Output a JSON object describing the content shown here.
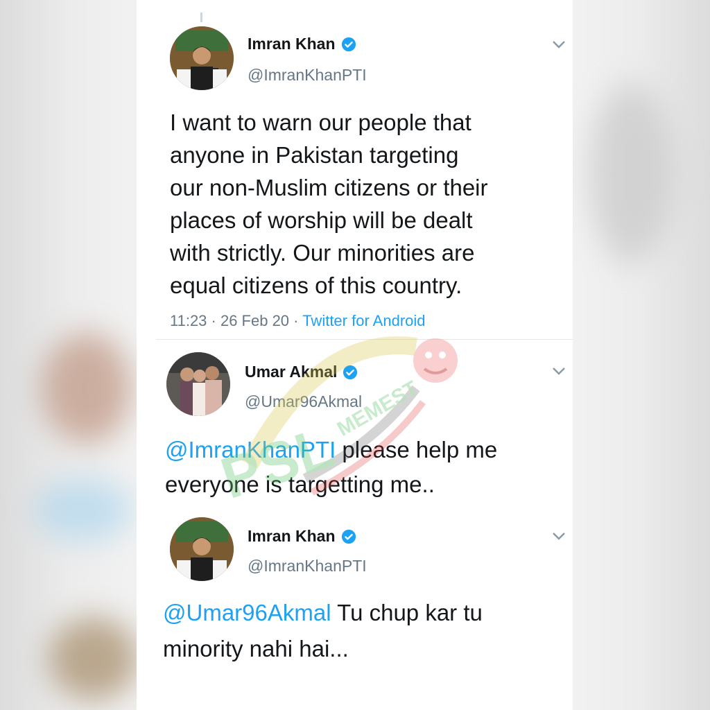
{
  "tweets": [
    {
      "name": "Imran Khan",
      "handle": "@ImranKhanPTI",
      "verified": true,
      "text": "I want to warn our people that anyone in Pakistan targeting our non-Muslim citizens or their places of worship will be dealt with strictly. Our minorities are equal citizens of this country.",
      "lines": [
        "I want to warn our people that",
        "anyone in Pakistan targeting",
        "our non-Muslim citizens or their",
        "places of worship will be dealt",
        "with strictly. Our minorities are",
        "equal citizens of this country."
      ],
      "time": "11:23 · 26 Feb 20 · ",
      "source": "Twitter for Android"
    },
    {
      "name": "Umar Akmal",
      "handle": "@Umar96Akmal",
      "verified": true,
      "mention": "@ImranKhanPTI",
      "line1_rest": " please help me",
      "line2": "everyone is targetting me.."
    },
    {
      "name": "Imran Khan",
      "handle": "@ImranKhanPTI",
      "verified": true,
      "mention": "@Umar96Akmal",
      "line1_rest": " Tu chup kar tu",
      "line2": "minority nahi hai..."
    }
  ],
  "watermark": {
    "text": "PSL",
    "subtext": "MEMEST"
  },
  "colors": {
    "accent": "#1da1f2",
    "verified": "#1da1f2",
    "text": "#14171a",
    "muted": "#657786"
  }
}
